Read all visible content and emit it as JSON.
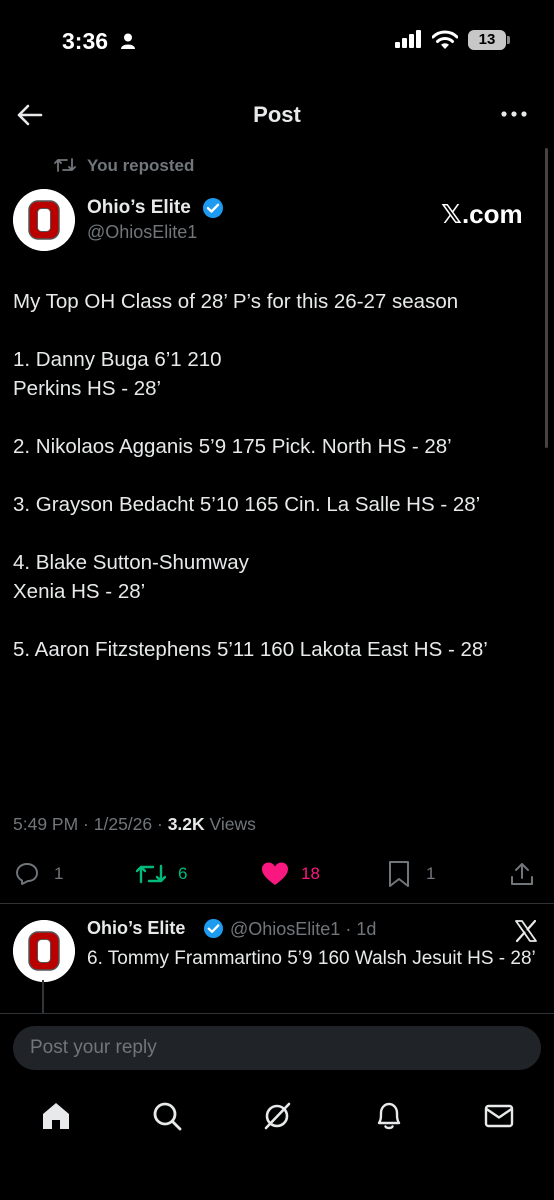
{
  "status_bar": {
    "time": "3:36",
    "battery": "13"
  },
  "header": {
    "title": "Post"
  },
  "repost": {
    "label": "You reposted"
  },
  "post": {
    "author_name": "Ohio’s Elite",
    "handle": "@OhiosElite1",
    "source_badge": "𝕏.com",
    "text": "My Top OH Class of 28’ P’s for this 26-27 season\n\n1. Danny Buga 6’1 210\nPerkins HS - 28’\n\n2. Nikolaos Agganis 5’9 175 Pick. North HS - 28’\n\n3. Grayson Bedacht 5’10 165 Cin. La Salle HS - 28’\n\n4. Blake Sutton-Shumway\nXenia HS - 28’\n\n5. Aaron Fitzstephens 5’11 160 Lakota East HS - 28’",
    "time": "5:49 PM",
    "date": "1/25/26",
    "views_count": "3.2K",
    "views_label": " Views",
    "sep": " · ",
    "replies": "1",
    "reposts": "6",
    "likes": "18",
    "bookmarks": "1"
  },
  "reply": {
    "author_name": "Ohio’s Elite",
    "handle": "@OhiosElite1 · 1d",
    "text": "6. Tommy Frammartino 5’9 160 Walsh Jesuit HS - 28’"
  },
  "composer": {
    "placeholder": "Post your reply"
  },
  "colors": {
    "accent": "#1d9bf0",
    "repost": "#00ba7c",
    "like": "#f91880",
    "muted": "#71767b",
    "logo_red": "#bb0000"
  },
  "icons": [
    "back-arrow-icon",
    "more-icon",
    "repost-icon",
    "verified-icon",
    "x-logo-icon",
    "reply-icon",
    "like-icon",
    "bookmark-icon",
    "share-icon",
    "home-icon",
    "search-icon",
    "grok-icon",
    "bell-icon",
    "mail-icon"
  ]
}
